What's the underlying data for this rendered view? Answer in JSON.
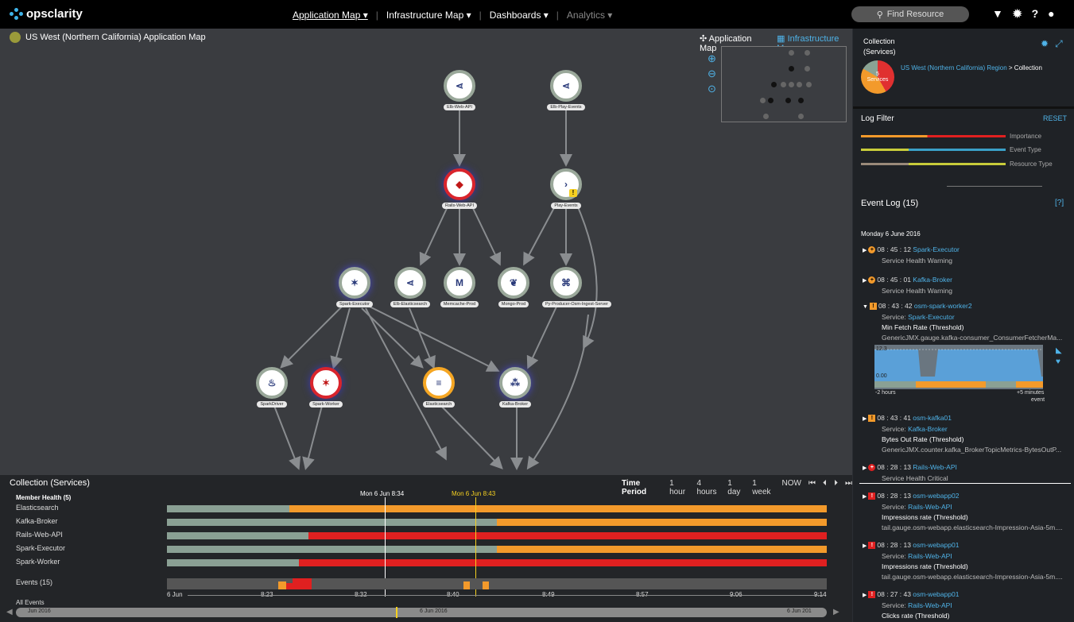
{
  "app": {
    "logo": "opsclarity"
  },
  "nav": {
    "items": [
      {
        "label": "Application Map ▾",
        "active": true
      },
      {
        "label": "Infrastructure Map ▾"
      },
      {
        "label": "Dashboards ▾"
      },
      {
        "label": "Analytics ▾",
        "dim": true
      }
    ],
    "search_placeholder": "Find Resource"
  },
  "map": {
    "title": "US West (Northern California) Application Map",
    "tab_app": "Application Map",
    "tab_infra": "Infrastructure Map",
    "nodes": [
      {
        "id": "elb-web-api",
        "label": "Elb-Web-API",
        "icon": "share-icon",
        "ring": "gray"
      },
      {
        "id": "elb-play-events",
        "label": "Elb-Play-Events",
        "icon": "share-icon",
        "ring": "gray"
      },
      {
        "id": "rails-web-api",
        "label": "Rails-Web-API",
        "icon": "ruby-icon",
        "ring": "red"
      },
      {
        "id": "play-events",
        "label": "Play-Events",
        "icon": "play-icon",
        "ring": "gray",
        "warn": "!"
      },
      {
        "id": "spark-executor",
        "label": "Spark-Executor",
        "icon": "spark-icon",
        "ring": "gray"
      },
      {
        "id": "elb-elasticsearch",
        "label": "Elb-Elasticsearch",
        "icon": "share-icon",
        "ring": "gray"
      },
      {
        "id": "memcache-prod",
        "label": "Memcache-Prod",
        "icon": "memcache-icon",
        "ring": "gray"
      },
      {
        "id": "mongo-prod",
        "label": "Mongo-Prod",
        "icon": "mongo-icon",
        "ring": "gray"
      },
      {
        "id": "py-producer",
        "label": "Py-Producer-Osm-Ingest-Server",
        "icon": "python-icon",
        "ring": "gray"
      },
      {
        "id": "spark-driver",
        "label": "SparkDriver",
        "icon": "java-icon",
        "ring": "gray"
      },
      {
        "id": "spark-worker",
        "label": "Spark-Worker",
        "icon": "spark-icon",
        "ring": "red"
      },
      {
        "id": "elasticsearch",
        "label": "Elasticsearch",
        "icon": "elastic-icon",
        "ring": "orange"
      },
      {
        "id": "kafka-broker",
        "label": "Kafka-Broker",
        "icon": "kafka-icon",
        "ring": "gray"
      }
    ]
  },
  "collection": {
    "title": "Collection (Services)",
    "time_label": "Time Period",
    "time_options": [
      "1 hour",
      "4 hours",
      "1 day",
      "1 week",
      "NOW"
    ],
    "member_health": "Member Health (5)",
    "rows": [
      {
        "name": "Elasticsearch",
        "green": 0.185,
        "color": "#f39a2b"
      },
      {
        "name": "Kafka-Broker",
        "green": 0.5,
        "color": "#f39a2b"
      },
      {
        "name": "Rails-Web-API",
        "green": 0.215,
        "color": "#e02020"
      },
      {
        "name": "Spark-Executor",
        "green": 0.5,
        "color": "#f39a2b"
      },
      {
        "name": "Spark-Worker",
        "green": 0.2,
        "color": "#e02020"
      }
    ],
    "marker1": "Mon 6 Jun 8:34",
    "marker2": "Mon 6 Jun 8:43",
    "events_label": "Events (15)",
    "all_events": "All Events",
    "axis": [
      "6 Jun",
      "8:23",
      "8:32",
      "8:40",
      "8:49",
      "8:57",
      "9:06",
      "9:14"
    ],
    "scroll": [
      "Jun 2016",
      "6 Jun 2016",
      "6 Jun 201"
    ]
  },
  "sidebar": {
    "title_line1": "Collection",
    "title_line2": "(Services)",
    "pie_count": "5",
    "pie_label": "Services",
    "region_link": "US West (Northern California) Region",
    "region_rest": " > Collection",
    "log_filter": "Log Filter",
    "reset": "RESET",
    "filters": [
      "Importance",
      "Event Type",
      "Resource Type"
    ],
    "event_log": "Event Log (15)",
    "help": "[?]",
    "day": "Monday 6 June 2016",
    "spark": {
      "max": "12.3",
      "min": "0.00",
      "left": "-2 hours",
      "right": "+5 minutes",
      "event": "event"
    },
    "events": [
      {
        "time": "08 : 45 : 12",
        "source": "Spark-Executor",
        "desc": "Service Health Warning",
        "kind": "circle-o"
      },
      {
        "time": "08 : 45 : 01",
        "source": "Kafka-Broker",
        "desc": "Service Health Warning",
        "kind": "circle-o"
      },
      {
        "time": "08 : 43 : 42",
        "source": "osm-spark-worker2",
        "service": "Spark-Executor",
        "metric": "Min Fetch Rate (Threshold)",
        "detail": "GenericJMX.gauge.kafka-consumer_ConsumerFetcherMa...",
        "kind": "square-o"
      },
      {
        "time": "08 : 43 : 41",
        "source": "osm-kafka01",
        "service": "Kafka-Broker",
        "metric": "Bytes Out Rate (Threshold)",
        "detail": "GenericJMX.counter.kafka_BrokerTopicMetrics-BytesOutP...",
        "kind": "square-o"
      },
      {
        "time": "08 : 28 : 13",
        "source": "Rails-Web-API",
        "desc": "Service Health Critical",
        "kind": "circle-r"
      },
      {
        "time": "08 : 28 : 13",
        "source": "osm-webapp02",
        "service": "Rails-Web-API",
        "metric": "Impressions rate (Threshold)",
        "detail": "tail.gauge.osm-webapp.elasticsearch-Impression-Asia-5m....",
        "kind": "square-r"
      },
      {
        "time": "08 : 28 : 13",
        "source": "osm-webapp01",
        "service": "Rails-Web-API",
        "metric": "Impressions rate (Threshold)",
        "detail": "tail.gauge.osm-webapp.elasticsearch-Impression-Asia-5m....",
        "kind": "square-r"
      },
      {
        "time": "08 : 27 : 43",
        "source": "osm-webapp01",
        "service": "Rails-Web-API",
        "metric": "Clicks rate (Threshold)",
        "kind": "square-r"
      }
    ],
    "service_prefix": "Service: "
  }
}
